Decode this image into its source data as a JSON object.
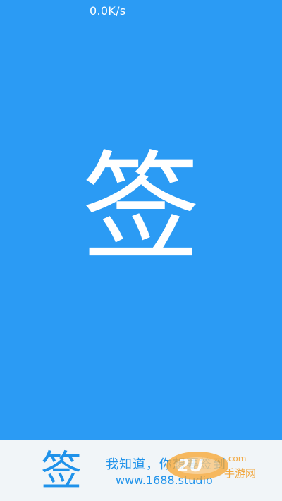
{
  "status_bar": {
    "net_speed": "0.0K/s"
  },
  "splash": {
    "logo_char": "签"
  },
  "footer": {
    "logo_char": "签",
    "tagline": "我知道，你想要签到",
    "website": "www.1688.studio"
  },
  "colors": {
    "background": "#2b9bf4",
    "footer_background": "#f1f5f8",
    "accent": "#1f92ea",
    "text_on_bg": "#ffffff"
  },
  "watermark": {
    "text": "2U",
    "suffix": "手游网",
    "domain_fragment": ".com"
  }
}
